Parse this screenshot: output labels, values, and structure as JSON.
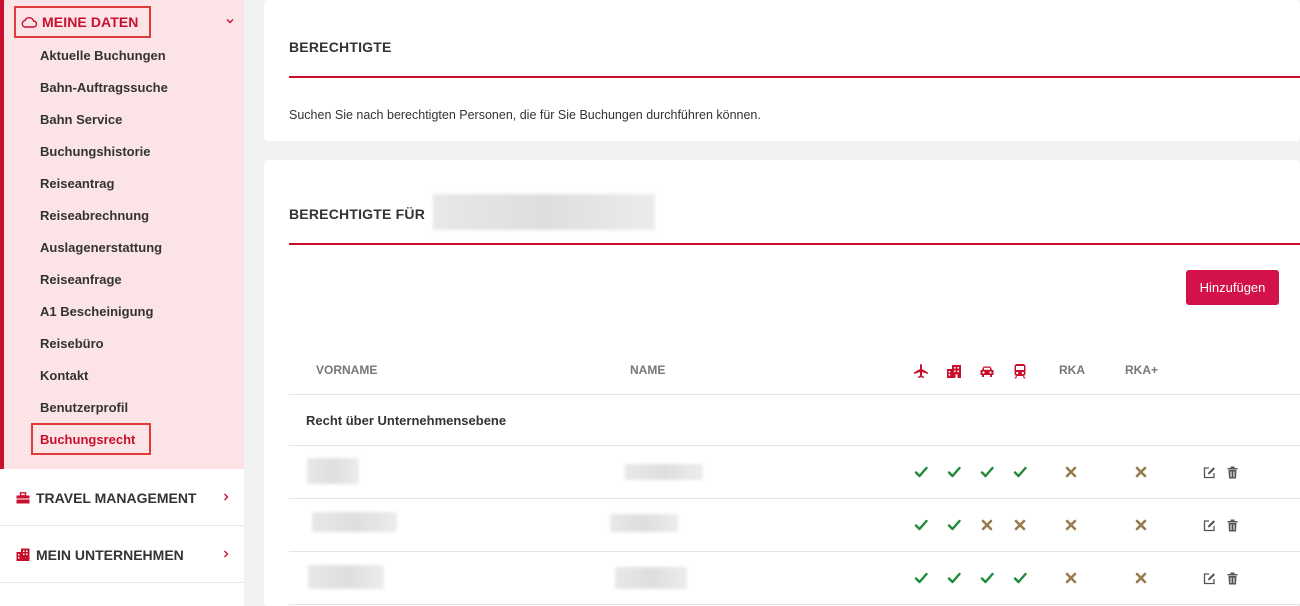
{
  "sidebar": {
    "open_section": {
      "label": "MEINE DATEN",
      "icon": "cloud-icon"
    },
    "items": [
      {
        "label": "Aktuelle Buchungen"
      },
      {
        "label": "Bahn-Auftragssuche"
      },
      {
        "label": "Bahn Service"
      },
      {
        "label": "Buchungshistorie"
      },
      {
        "label": "Reiseantrag"
      },
      {
        "label": "Reiseabrechnung"
      },
      {
        "label": "Auslagenerstattung"
      },
      {
        "label": "Reiseanfrage"
      },
      {
        "label": "A1 Bescheinigung"
      },
      {
        "label": "Reisebüro"
      },
      {
        "label": "Kontakt"
      },
      {
        "label": "Benutzerprofil"
      },
      {
        "label": "Buchungsrecht",
        "active": true
      }
    ],
    "sections": [
      {
        "label": "TRAVEL MANAGEMENT",
        "icon": "briefcase-icon"
      },
      {
        "label": "MEIN UNTERNEHMEN",
        "icon": "building-icon"
      }
    ]
  },
  "card1": {
    "title": "BERECHTIGTE",
    "description": "Suchen Sie nach berechtigten Personen, die für Sie Buchungen durchführen können."
  },
  "card2": {
    "title": "BERECHTIGTE FÜR",
    "add_button": "Hinzufügen",
    "columns": {
      "first_name": "VORNAME",
      "last_name": "NAME",
      "icons": [
        "plane-icon",
        "hotel-icon",
        "car-icon",
        "train-icon"
      ],
      "rka": "RKA",
      "rka_plus": "RKA+"
    },
    "company_row": "Recht über Unternehmensebene",
    "rows": [
      {
        "flight": true,
        "hotel": true,
        "car": true,
        "train": true,
        "rka": false,
        "rka_plus": false
      },
      {
        "flight": true,
        "hotel": true,
        "car": false,
        "train": false,
        "rka": false,
        "rka_plus": false
      },
      {
        "flight": true,
        "hotel": true,
        "car": true,
        "train": true,
        "rka": false,
        "rka_plus": false
      }
    ]
  },
  "colors": {
    "accent": "#c8102e",
    "button": "#d3124a",
    "check": "#1f8a3c",
    "cross": "#9a7b4f",
    "sidebar_open_bg": "#fce4e6"
  }
}
